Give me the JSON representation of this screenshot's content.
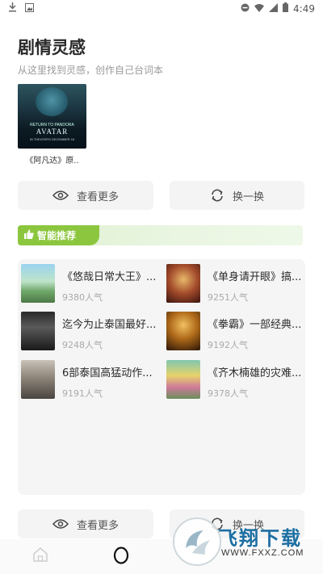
{
  "status_bar": {
    "time": "4:49"
  },
  "header": {
    "title": "剧情灵感",
    "subtitle": "从这里找到灵感，创作自己台词本"
  },
  "featured": {
    "caption": "《阿凡达》原..",
    "poster_line1": "RETURN TO PANDORA",
    "poster_title": "AVATAR",
    "poster_line3": "IN THEATERS DECEMBER 16"
  },
  "actions": {
    "more_label": "查看更多",
    "shuffle_label": "换一换"
  },
  "recommend": {
    "title": "智能推荐"
  },
  "items": [
    {
      "name": "《悠哉日常大王》...",
      "popularity": "9380人气"
    },
    {
      "name": "《单身请开眼》搞...",
      "popularity": "9251人气"
    },
    {
      "name": "迄今为止泰国最好...",
      "popularity": "9248人气"
    },
    {
      "name": "《拳霸》一部经典...",
      "popularity": "9192人气"
    },
    {
      "name": "6部泰国高猛动作...",
      "popularity": "9191人气"
    },
    {
      "name": "《齐木楠雄的灾难...",
      "popularity": "9378人气"
    }
  ],
  "bottom_actions": {
    "more_label": "查看更多",
    "shuffle_label": "换一换"
  },
  "watermark": {
    "text": "飞翔下载",
    "url": "WWW.FXXZ.COM"
  },
  "icons": [
    "download-icon",
    "image-icon",
    "dnd-icon",
    "wifi-icon",
    "signal-icon",
    "battery-icon",
    "eye-icon",
    "refresh-icon",
    "thumbs-up-icon",
    "home-icon",
    "circle-icon"
  ],
  "colors": {
    "accent_green": "#8cc63f",
    "banner_bg": "#e6f3dc",
    "panel_bg": "#f5f5f5",
    "watermark_blue": "#1d6fa3"
  }
}
